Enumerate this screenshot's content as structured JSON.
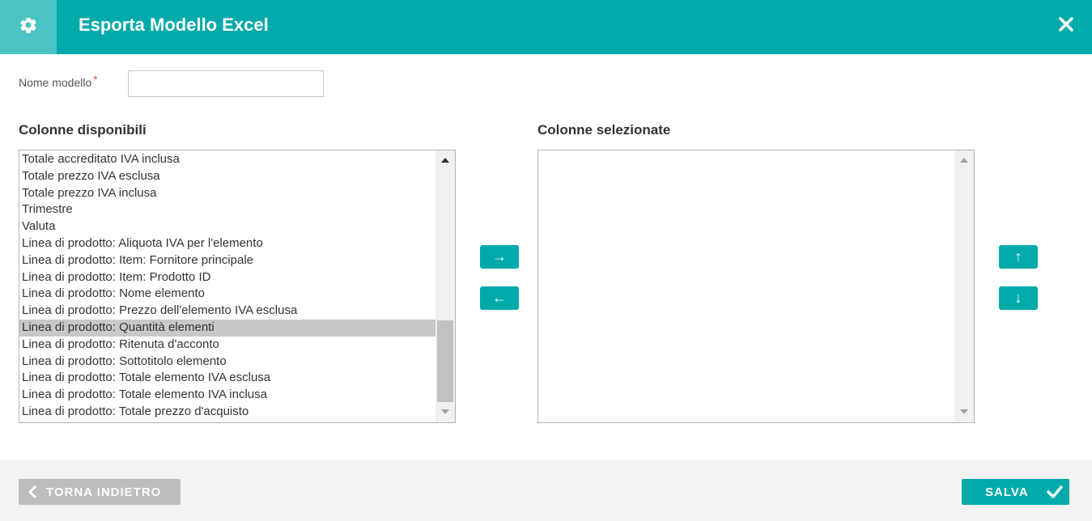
{
  "dialog": {
    "title": "Esporta Modello Excel",
    "accent_color": "#00aaaa"
  },
  "form": {
    "name_label": "Nome modello",
    "required_mark": "*",
    "name_value": "",
    "name_placeholder": ""
  },
  "available": {
    "title": "Colonne disponibili",
    "items": [
      "Totale accreditato IVA inclusa",
      "Totale prezzo IVA esclusa",
      "Totale prezzo IVA inclusa",
      "Trimestre",
      "Valuta",
      "Linea di prodotto: Aliquota IVA per l'elemento",
      "Linea di prodotto: Item: Fornitore principale",
      "Linea di prodotto: Item: Prodotto ID",
      "Linea di prodotto: Nome elemento",
      "Linea di prodotto: Prezzo dell'elemento IVA esclusa",
      "Linea di prodotto: Quantità elementi",
      "Linea di prodotto: Ritenuta d'acconto",
      "Linea di prodotto: Sottotitolo elemento",
      "Linea di prodotto: Totale elemento IVA esclusa",
      "Linea di prodotto: Totale elemento IVA inclusa",
      "Linea di prodotto: Totale prezzo d'acquisto"
    ],
    "selected_item": "Linea di prodotto: Quantità elementi"
  },
  "selected": {
    "title": "Colonne selezionate",
    "items": []
  },
  "transfer": {
    "add_label": "→",
    "remove_label": "←"
  },
  "order": {
    "up_label": "↑",
    "down_label": "↓"
  },
  "footer": {
    "back_label": "TORNA INDIETRO",
    "save_label": "SALVA"
  }
}
